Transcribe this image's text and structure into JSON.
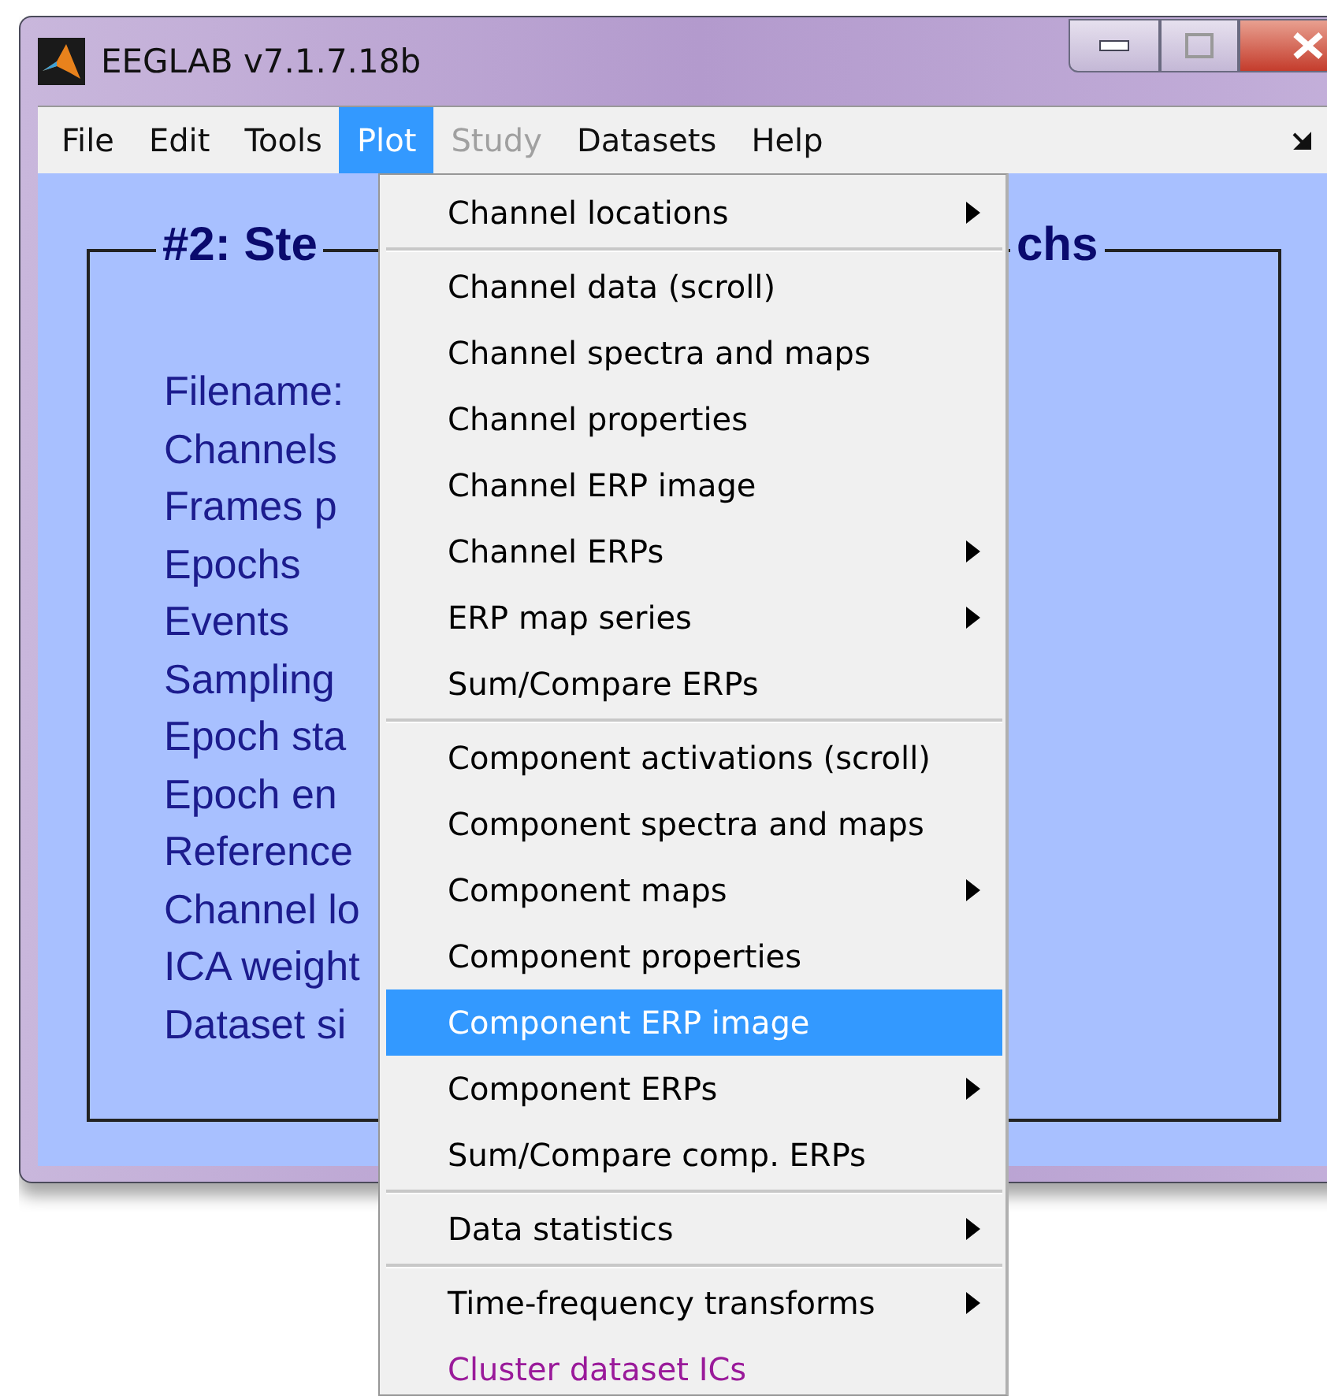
{
  "window": {
    "title": "EEGLAB v7.1.7.18b"
  },
  "menu_bar": [
    {
      "label": "File",
      "selected": false,
      "disabled": false
    },
    {
      "label": "Edit",
      "selected": false,
      "disabled": false
    },
    {
      "label": "Tools",
      "selected": false,
      "disabled": false
    },
    {
      "label": "Plot",
      "selected": true,
      "disabled": false
    },
    {
      "label": "Study",
      "selected": false,
      "disabled": true
    },
    {
      "label": "Datasets",
      "selected": false,
      "disabled": false
    },
    {
      "label": "Help",
      "selected": false,
      "disabled": false
    }
  ],
  "panel": {
    "title_left": "#2: Ste",
    "title_right": "chs",
    "labels": [
      "Filename:",
      "Channels",
      "Frames p",
      "Epochs",
      "Events",
      "Sampling",
      "Epoch sta",
      "Epoch en",
      "Reference",
      "Channel lo",
      "ICA weight",
      "Dataset si"
    ]
  },
  "popup_menu": {
    "sections": [
      [
        {
          "label": "Channel locations",
          "submenu": true,
          "selected": false,
          "color": "#000000"
        }
      ],
      [
        {
          "label": "Channel data (scroll)",
          "submenu": false,
          "selected": false,
          "color": "#000000"
        },
        {
          "label": "Channel spectra and maps",
          "submenu": false,
          "selected": false,
          "color": "#000000"
        },
        {
          "label": "Channel properties",
          "submenu": false,
          "selected": false,
          "color": "#000000"
        },
        {
          "label": "Channel ERP image",
          "submenu": false,
          "selected": false,
          "color": "#000000"
        },
        {
          "label": "Channel ERPs",
          "submenu": true,
          "selected": false,
          "color": "#000000"
        },
        {
          "label": "ERP map series",
          "submenu": true,
          "selected": false,
          "color": "#000000"
        },
        {
          "label": "Sum/Compare ERPs",
          "submenu": false,
          "selected": false,
          "color": "#000000"
        }
      ],
      [
        {
          "label": "Component activations (scroll)",
          "submenu": false,
          "selected": false,
          "color": "#000000"
        },
        {
          "label": "Component spectra and maps",
          "submenu": false,
          "selected": false,
          "color": "#000000"
        },
        {
          "label": "Component maps",
          "submenu": true,
          "selected": false,
          "color": "#000000"
        },
        {
          "label": "Component properties",
          "submenu": false,
          "selected": false,
          "color": "#000000"
        },
        {
          "label": "Component ERP image",
          "submenu": false,
          "selected": true,
          "color": "#ffffff"
        },
        {
          "label": "Component ERPs",
          "submenu": true,
          "selected": false,
          "color": "#000000"
        },
        {
          "label": "Sum/Compare comp. ERPs",
          "submenu": false,
          "selected": false,
          "color": "#000000"
        }
      ],
      [
        {
          "label": "Data statistics",
          "submenu": true,
          "selected": false,
          "color": "#000000"
        }
      ],
      [
        {
          "label": "Time-frequency transforms",
          "submenu": true,
          "selected": false,
          "color": "#000000"
        },
        {
          "label": "Cluster dataset ICs",
          "submenu": false,
          "selected": false,
          "color": "#9a1a9a"
        }
      ]
    ]
  }
}
